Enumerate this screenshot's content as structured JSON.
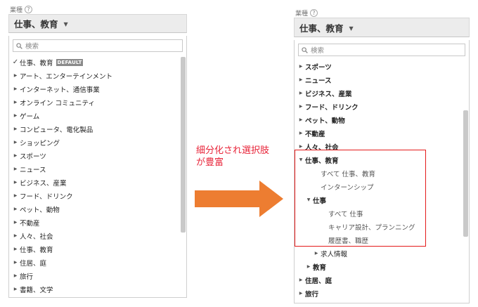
{
  "left_panel": {
    "section_label": "業種",
    "help": "?",
    "dropdown_value": "仕事、教育",
    "search_placeholder": "検索",
    "items": [
      {
        "label": "仕事、教育",
        "checked": true,
        "badge": "DEFAULT"
      },
      {
        "label": "アート、エンターテインメント"
      },
      {
        "label": "インターネット、通信事業"
      },
      {
        "label": "オンライン コミュニティ"
      },
      {
        "label": "ゲーム"
      },
      {
        "label": "コンピュータ、電化製品"
      },
      {
        "label": "ショッピング"
      },
      {
        "label": "スポーツ"
      },
      {
        "label": "ニュース"
      },
      {
        "label": "ビジネス、産業"
      },
      {
        "label": "フード、ドリンク"
      },
      {
        "label": "ペット、動物"
      },
      {
        "label": "不動産"
      },
      {
        "label": "人々、社会"
      },
      {
        "label": "仕事、教育"
      },
      {
        "label": "住居、庭"
      },
      {
        "label": "旅行"
      },
      {
        "label": "書籍、文学"
      }
    ]
  },
  "annotation": {
    "line1": "細分化され選択肢",
    "line2": "が豊富",
    "arrow_color": "#ed7d31",
    "highlight_color": "#e41a1a"
  },
  "right_panel": {
    "section_label": "業種",
    "help": "?",
    "dropdown_value": "仕事、教育",
    "search_placeholder": "検索",
    "items": [
      {
        "label": "スポーツ",
        "indent": 0,
        "expander": "collapsed"
      },
      {
        "label": "ニュース",
        "indent": 0,
        "expander": "collapsed"
      },
      {
        "label": "ビジネス、産業",
        "indent": 0,
        "expander": "collapsed"
      },
      {
        "label": "フード、ドリンク",
        "indent": 0,
        "expander": "collapsed"
      },
      {
        "label": "ペット、動物",
        "indent": 0,
        "expander": "collapsed"
      },
      {
        "label": "不動産",
        "indent": 0,
        "expander": "collapsed"
      },
      {
        "label": "人々、社会",
        "indent": 0,
        "expander": "collapsed"
      },
      {
        "label": "仕事、教育",
        "indent": 0,
        "expander": "expanded"
      },
      {
        "label": "すべて 仕事、教育",
        "indent": 2,
        "expander": "none"
      },
      {
        "label": "インターンシップ",
        "indent": 2,
        "expander": "none"
      },
      {
        "label": "仕事",
        "indent": 1,
        "expander": "expanded"
      },
      {
        "label": "すべて 仕事",
        "indent": 3,
        "expander": "none"
      },
      {
        "label": "キャリア設計、プランニング",
        "indent": 3,
        "expander": "none"
      },
      {
        "label": "履歴書、職歴",
        "indent": 3,
        "expander": "none"
      },
      {
        "label": "求人情報",
        "indent": 2,
        "expander": "collapsed"
      },
      {
        "label": "教育",
        "indent": 1,
        "expander": "collapsed"
      },
      {
        "label": "住居、庭",
        "indent": 0,
        "expander": "collapsed"
      },
      {
        "label": "旅行",
        "indent": 0,
        "expander": "collapsed"
      }
    ]
  }
}
